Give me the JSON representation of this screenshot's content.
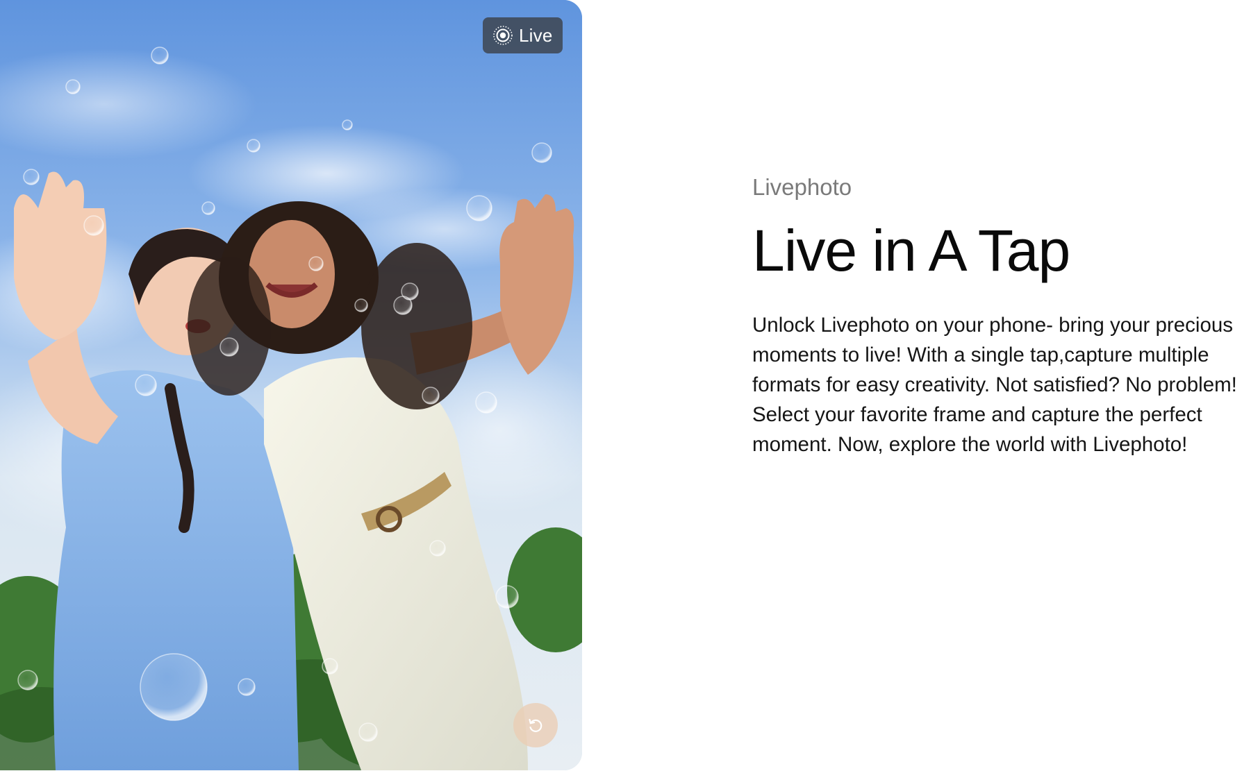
{
  "photo": {
    "badge_label": "Live",
    "badge_icon": "live-photo-icon",
    "replay_icon": "replay-icon"
  },
  "content": {
    "eyebrow": "Livephoto",
    "headline": "Live in A Tap",
    "body": "Unlock Livephoto on your phone- bring your precious moments to live! With a single tap,capture multiple formats for easy creativity. Not satisfied? No problem! Select your favorite frame and capture the perfect moment. Now, explore the world with Livephoto!"
  },
  "colors": {
    "page_background": "#ffffff",
    "eyebrow_text": "#7a7a7a",
    "headline_text": "#0a0a0a",
    "body_text": "#151515",
    "badge_background": "#3c424a",
    "replay_background": "#ebcdb4"
  }
}
